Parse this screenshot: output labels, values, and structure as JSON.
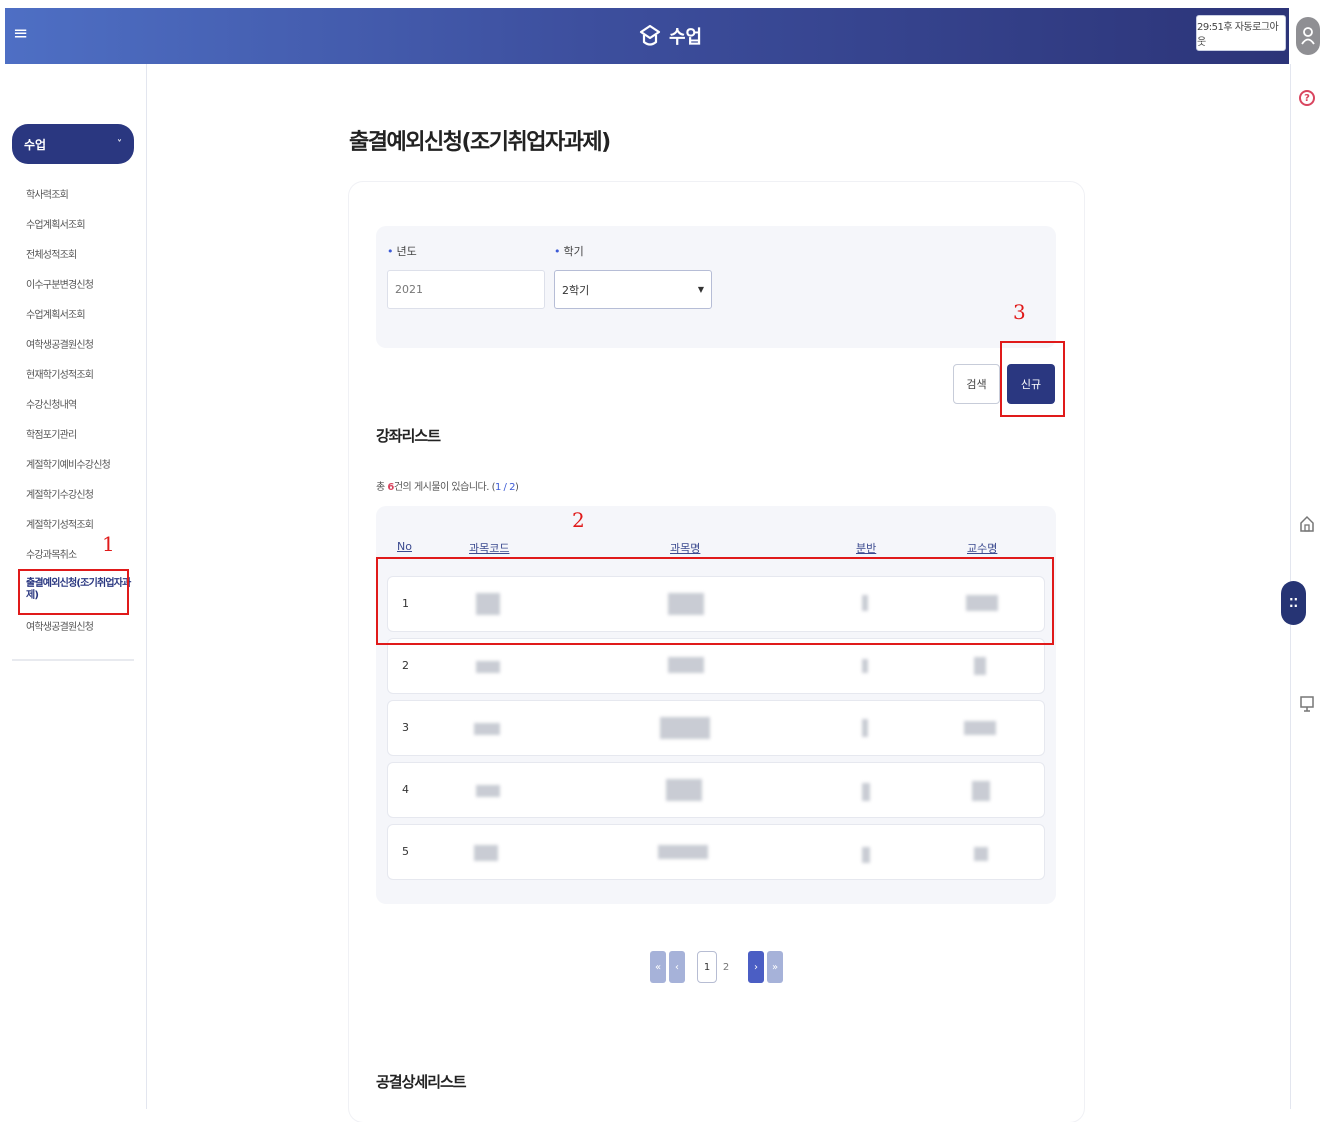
{
  "header": {
    "title": "수업",
    "logout_timer": "29:51후 자동로그아웃"
  },
  "sidebar": {
    "select_label": "수업",
    "items": [
      {
        "label": "학사력조회"
      },
      {
        "label": "수업계획서조회"
      },
      {
        "label": "전체성적조회"
      },
      {
        "label": "이수구분변경신청"
      },
      {
        "label": "수업계획서조회"
      },
      {
        "label": "여학생공결원신청"
      },
      {
        "label": "현재학기성적조회"
      },
      {
        "label": "수강신청내역"
      },
      {
        "label": "학점포기관리"
      },
      {
        "label": "계절학기예비수강신청"
      },
      {
        "label": "계절학기수강신청"
      },
      {
        "label": "계절학기성적조회"
      },
      {
        "label": "수강과목취소"
      },
      {
        "label": "출결예외신청(조기취업자과제)"
      },
      {
        "label": "여학생공결원신청"
      }
    ]
  },
  "main": {
    "title": "출결예외신청(조기취업자과제)",
    "search": {
      "year_label": "년도",
      "year_value": "2021",
      "term_label": "학기",
      "term_value": "2학기"
    },
    "buttons": {
      "search": "검색",
      "new": "신규"
    },
    "course_list_title": "강좌리스트",
    "count": {
      "prefix": "총",
      "num": "6",
      "suffix": "건의 게시물이 있습니다.",
      "page": "1 / 2"
    },
    "table": {
      "headers": [
        "No",
        "과목코드",
        "과목명",
        "분반",
        "교수명"
      ],
      "rows": [
        {
          "no": "1"
        },
        {
          "no": "2"
        },
        {
          "no": "3"
        },
        {
          "no": "4"
        },
        {
          "no": "5"
        }
      ]
    },
    "pagination": {
      "pages": [
        "1",
        "2"
      ],
      "first": "«",
      "prev": "‹",
      "next": "›",
      "last": "»"
    },
    "detail_list_title": "공결상세리스트"
  },
  "annotations": {
    "n1": "1",
    "n2": "2",
    "n3": "3"
  },
  "colors": {
    "accent": "#2a3780",
    "annotation": "#e01a1a",
    "header_start": "#4e6fc4",
    "header_end": "#2c3478"
  }
}
